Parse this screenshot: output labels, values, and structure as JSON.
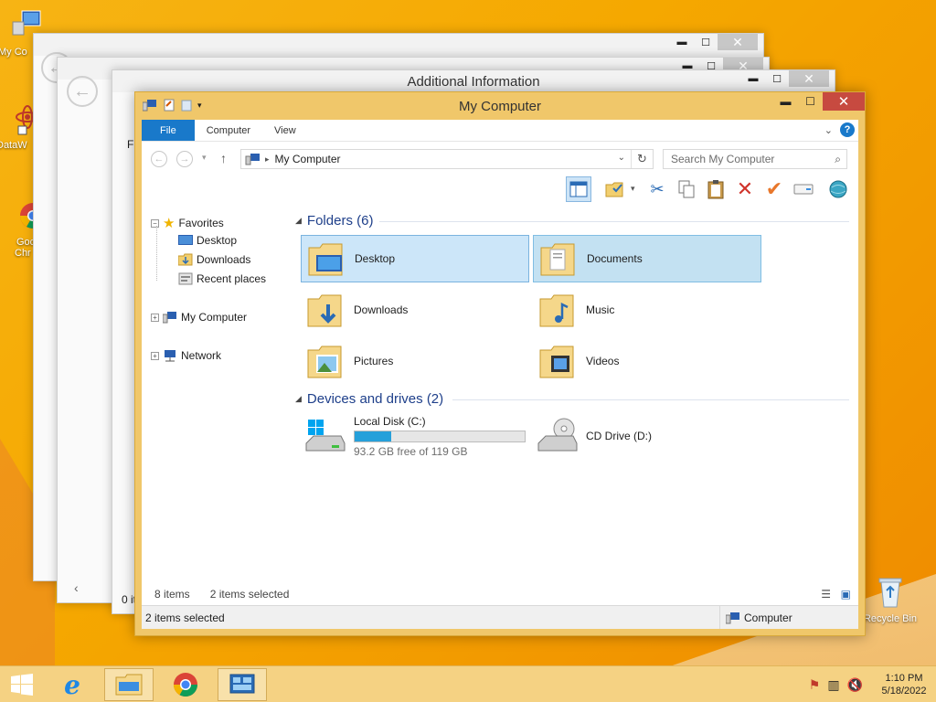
{
  "desktop": {
    "icons": [
      {
        "label": "My Co"
      },
      {
        "label": "DataW"
      },
      {
        "label": "Goo"
      },
      {
        "label": "Chr"
      },
      {
        "label": "Recycle Bin"
      }
    ]
  },
  "bg_windows": {
    "win3_title": "Additional Information",
    "win3_status": "Fi",
    "win3_bottom": "0 it"
  },
  "window": {
    "title": "My Computer",
    "ribbon": {
      "file": "File",
      "computer": "Computer",
      "view": "View",
      "help": "?"
    },
    "address": {
      "location": "My Computer",
      "search_placeholder": "Search My Computer"
    },
    "nav": {
      "favorites": "Favorites",
      "desktop": "Desktop",
      "downloads": "Downloads",
      "recent": "Recent places",
      "my_computer": "My Computer",
      "network": "Network"
    },
    "groups": {
      "folders": "Folders (6)",
      "devices": "Devices and drives (2)"
    },
    "folders": [
      {
        "label": "Desktop"
      },
      {
        "label": "Documents"
      },
      {
        "label": "Downloads"
      },
      {
        "label": "Music"
      },
      {
        "label": "Pictures"
      },
      {
        "label": "Videos"
      }
    ],
    "drives": {
      "c_label": "Local Disk (C:)",
      "c_free": "93.2 GB free of 119 GB",
      "c_used_fraction": 0.217,
      "d_label": "CD Drive (D:)"
    },
    "status": {
      "items": "8 items",
      "selected": "2 items selected",
      "bar_selected": "2 items selected",
      "bar_location": "Computer"
    }
  },
  "taskbar": {
    "time": "1:10 PM",
    "date": "5/18/2022"
  }
}
